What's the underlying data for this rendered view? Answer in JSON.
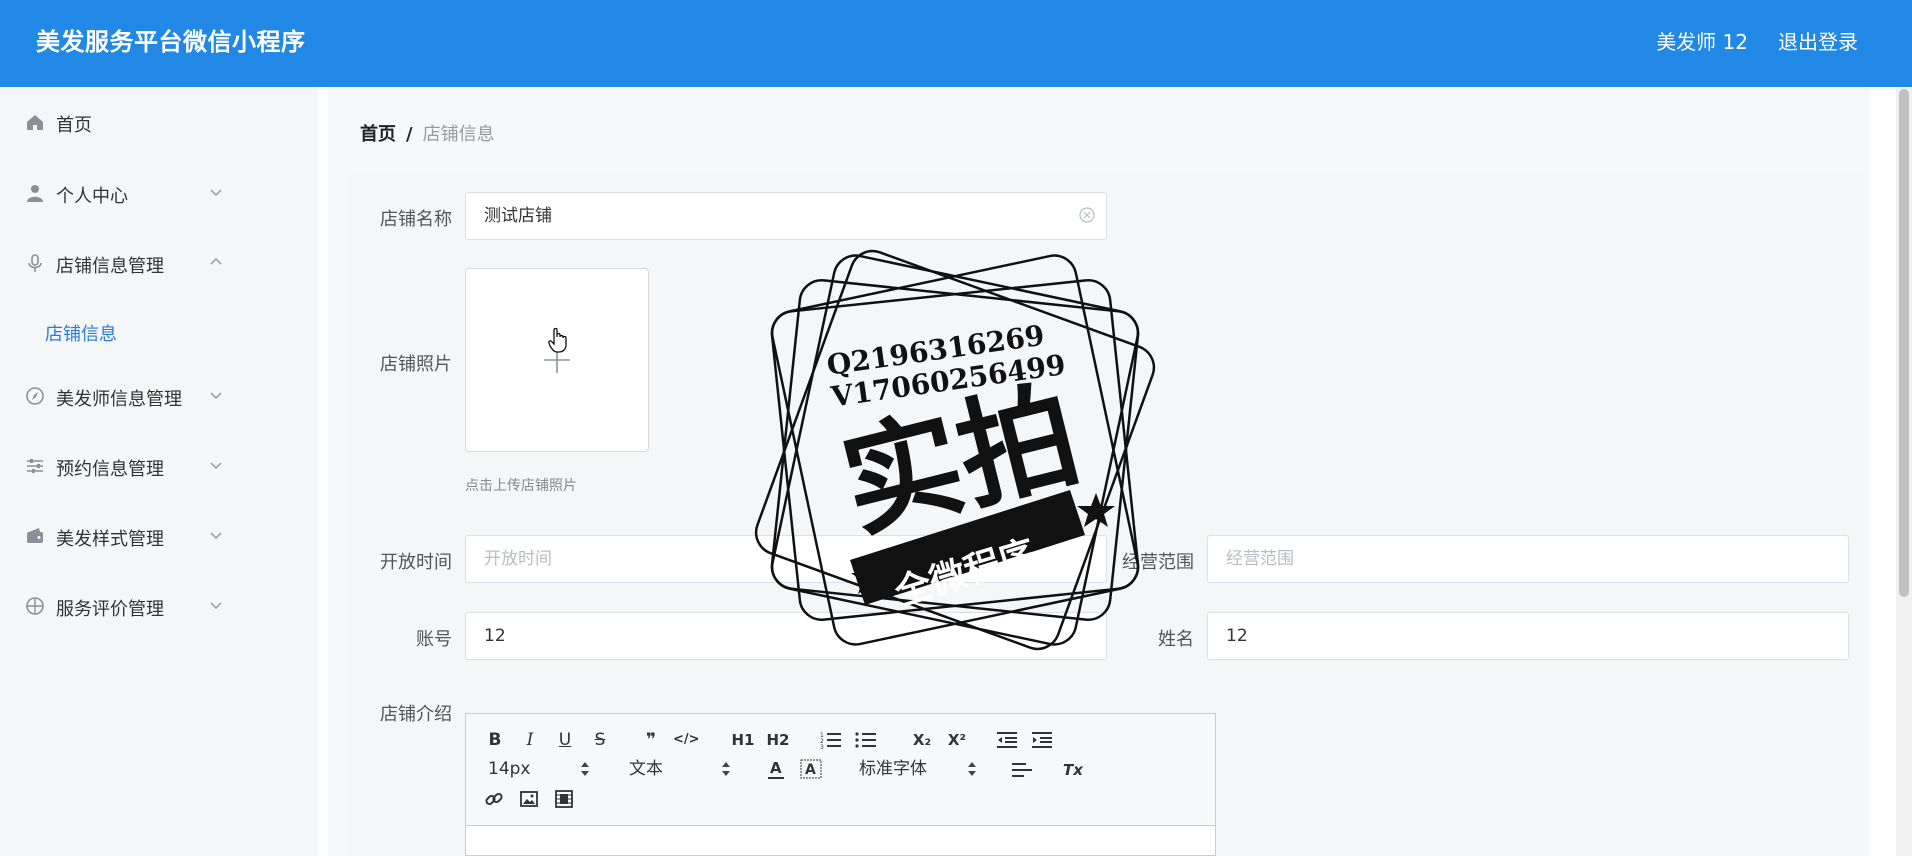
{
  "header": {
    "title": "美发服务平台微信小程序",
    "user": "美发师 12",
    "logout": "退出登录",
    "color": "#2188e5"
  },
  "sidebar": {
    "items": [
      {
        "label": "首页",
        "icon": "home-icon"
      },
      {
        "label": "个人中心",
        "icon": "user-icon"
      },
      {
        "label": "店铺信息管理",
        "icon": "microphone-icon",
        "expanded": true,
        "children": [
          {
            "label": "店铺信息"
          }
        ]
      },
      {
        "label": "美发师信息管理",
        "icon": "compass-icon"
      },
      {
        "label": "预约信息管理",
        "icon": "sliders-icon"
      },
      {
        "label": "美发样式管理",
        "icon": "wallet-icon"
      },
      {
        "label": "服务评价管理",
        "icon": "crosshair-icon"
      }
    ],
    "active_color": "#2b7cd6"
  },
  "breadcrumb": {
    "home": "首页",
    "separator": "/",
    "current": "店铺信息"
  },
  "form": {
    "shop_name_label": "店铺名称",
    "shop_name_value": "测试店铺",
    "shop_photo_label": "店铺照片",
    "upload_hint": "点击上传店铺照片",
    "open_time_label": "开放时间",
    "open_time_placeholder": "开放时间",
    "scope_label": "经营范围",
    "scope_placeholder": "经营范围",
    "account_label": "账号",
    "account_value": "12",
    "name_label": "姓名",
    "name_value": "12",
    "intro_label": "店铺介绍"
  },
  "editor": {
    "font_size": "14px",
    "block_type": "文本",
    "font_family": "标准字体",
    "buttons": {
      "bold": "B",
      "italic": "I",
      "underline": "U",
      "strike": "S",
      "quote": "❞",
      "code": "</>",
      "h1": "H1",
      "h2": "H2",
      "subscript": "X₂",
      "superscript": "X²",
      "clear_format": "Tx"
    }
  },
  "watermark": {
    "line1": "Q2196316269",
    "line2": "V17060256499",
    "main_text": "实拍",
    "ribbon_text": "全微程序"
  }
}
